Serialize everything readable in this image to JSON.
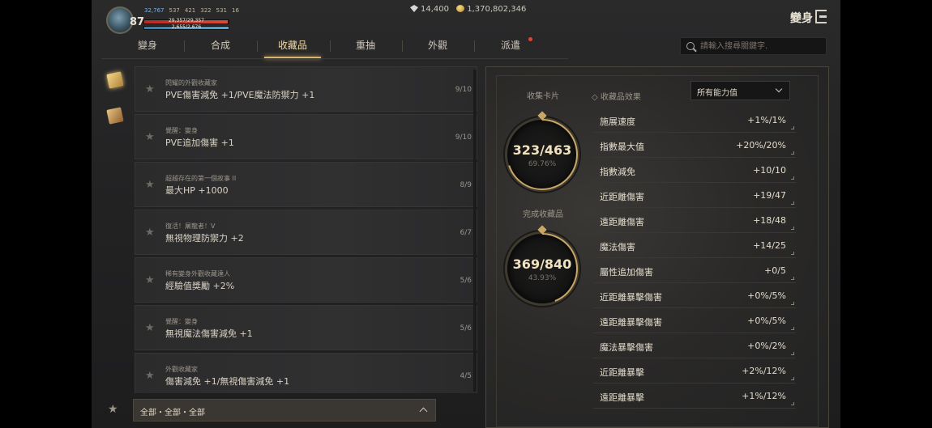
{
  "player": {
    "level": "87",
    "combat_power": "32,767",
    "stat_a": "537",
    "stat_b": "421",
    "stat_c": "322",
    "stat_d": "531",
    "stat_e": "16",
    "hp_text": "29,357/29,357",
    "mp_text": "2,655/2,676"
  },
  "currency": {
    "diamonds": "14,400",
    "gold": "1,370,802,346"
  },
  "header": {
    "title": "變身"
  },
  "tabs": [
    {
      "label": "變身"
    },
    {
      "label": "合成"
    },
    {
      "label": "收藏品"
    },
    {
      "label": "重抽"
    },
    {
      "label": "外觀"
    },
    {
      "label": "派遣"
    }
  ],
  "search": {
    "placeholder": "請輸入搜尋關鍵字."
  },
  "collections": [
    {
      "sub": "閃耀的外觀收藏家",
      "main": "PVE傷害減免 +1/PVE魔法防禦力 +1",
      "count": "9/10"
    },
    {
      "sub": "覺醒：變身",
      "main": "PVE追加傷害 +1",
      "count": "9/10"
    },
    {
      "sub": "超越存在的第一個故事 II",
      "main": "最大HP +1000",
      "count": "8/9"
    },
    {
      "sub": "復活！屠龍者！V",
      "main": "無視物理防禦力 +2",
      "count": "6/7"
    },
    {
      "sub": "稀有變身外觀收藏達人",
      "main": "經驗值獎勵 +2%",
      "count": "5/6"
    },
    {
      "sub": "覺醒：變身",
      "main": "無視魔法傷害減免 +1",
      "count": "5/6"
    },
    {
      "sub": "外觀收藏家",
      "main": "傷害減免 +1/無視傷害減免 +1",
      "count": "4/5"
    }
  ],
  "filter": {
    "label": "全部・全部・全部"
  },
  "summary": {
    "cards_label": "收集卡片",
    "cards_value": "323/463",
    "cards_pct": "69.76%",
    "cards_fraction": 0.6976,
    "done_label": "完成收藏品",
    "done_value": "369/840",
    "done_pct": "43.93%",
    "done_fraction": 0.4393
  },
  "effects": {
    "label": "收藏品效果",
    "select_value": "所有能力值",
    "stats": [
      {
        "name": "施展速度",
        "value": "+1%/1%"
      },
      {
        "name": "指數最大值",
        "value": "+20%/20%"
      },
      {
        "name": "指數減免",
        "value": "+10/10"
      },
      {
        "name": "近距離傷害",
        "value": "+19/47"
      },
      {
        "name": "遠距離傷害",
        "value": "+18/48"
      },
      {
        "name": "魔法傷害",
        "value": "+14/25"
      },
      {
        "name": "屬性追加傷害",
        "value": "+0/5"
      },
      {
        "name": "近距離暴擊傷害",
        "value": "+0%/5%"
      },
      {
        "name": "遠距離暴擊傷害",
        "value": "+0%/5%"
      },
      {
        "name": "魔法暴擊傷害",
        "value": "+0%/2%"
      },
      {
        "name": "近距離暴擊",
        "value": "+2%/12%"
      },
      {
        "name": "遠距離暴擊",
        "value": "+1%/12%"
      }
    ]
  }
}
